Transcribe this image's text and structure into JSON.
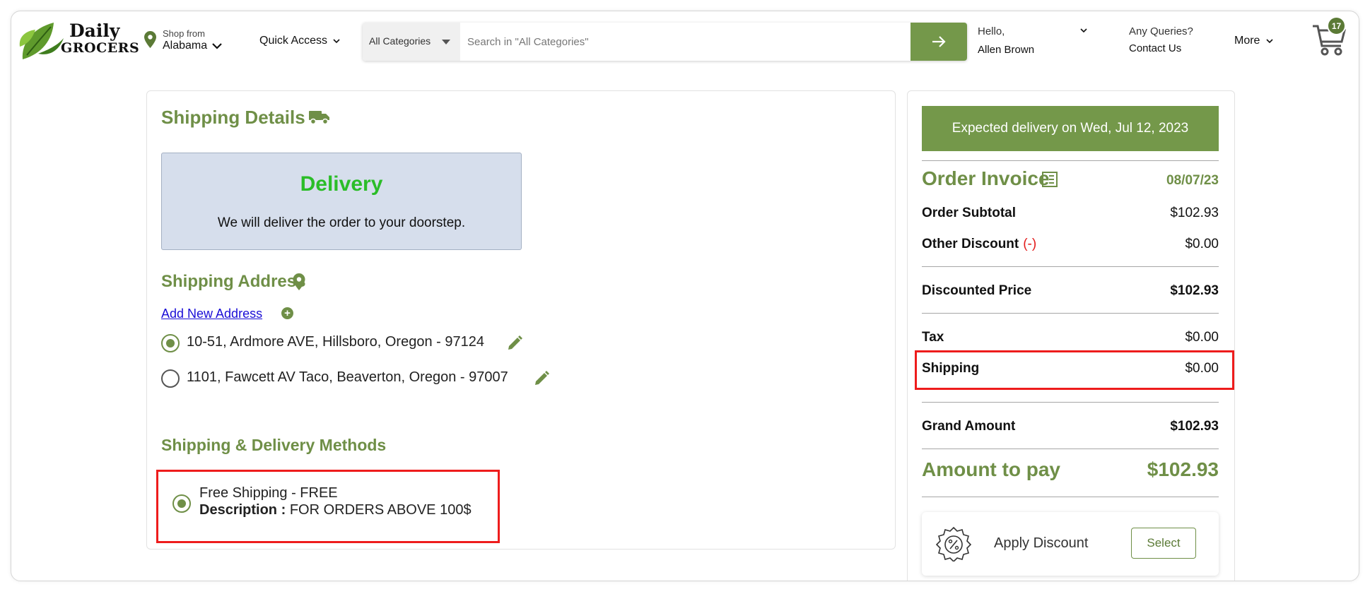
{
  "header": {
    "logo_top": "Daily",
    "logo_bottom": "GROCERS",
    "shop_from_label": "Shop from",
    "shop_from_value": "Alabama",
    "quick_access": "Quick Access",
    "search_category": "All Categories",
    "search_placeholder": "Search in \"All Categories\"",
    "greeting": "Hello,",
    "user_name": "Allen Brown",
    "queries_label": "Any Queries?",
    "contact_us": "Contact Us",
    "more": "More",
    "cart_count": "17"
  },
  "shipping": {
    "title": "Shipping Details",
    "delivery_title": "Delivery",
    "delivery_desc": "We will deliver the order to your doorstep.",
    "address_title": "Shipping Address",
    "add_new_address": "Add New Address",
    "addresses": [
      {
        "text": "10-51, Ardmore AVE, Hillsboro, Oregon - 97124",
        "selected": true
      },
      {
        "text": "1101, Fawcett AV Taco, Beaverton, Oregon - 97007",
        "selected": false
      }
    ],
    "methods_title": "Shipping & Delivery Methods",
    "method_name": "Free Shipping - FREE",
    "method_desc_label": "Description :",
    "method_desc_value": "FOR ORDERS ABOVE 100$"
  },
  "invoice": {
    "expected_delivery": "Expected delivery on Wed, Jul 12, 2023",
    "title": "Order Invoice",
    "date": "08/07/23",
    "order_subtotal_label": "Order Subtotal",
    "order_subtotal_value": "$102.93",
    "other_discount_label": "Other Discount",
    "other_discount_sign": "(-)",
    "other_discount_value": "$0.00",
    "discounted_price_label": "Discounted Price",
    "discounted_price_value": "$102.93",
    "tax_label": "Tax",
    "tax_value": "$0.00",
    "shipping_label": "Shipping",
    "shipping_value": "$0.00",
    "grand_amount_label": "Grand Amount",
    "grand_amount_value": "$102.93",
    "amount_to_pay_label": "Amount to pay",
    "amount_to_pay_value": "$102.93",
    "apply_discount": "Apply Discount",
    "select": "Select"
  },
  "colors": {
    "brand_green": "#74984a",
    "title_green": "#6f8f47",
    "delivery_green": "#2bbd28",
    "highlight_red": "#ee1c1c",
    "link_blue": "#1a0dd6"
  }
}
